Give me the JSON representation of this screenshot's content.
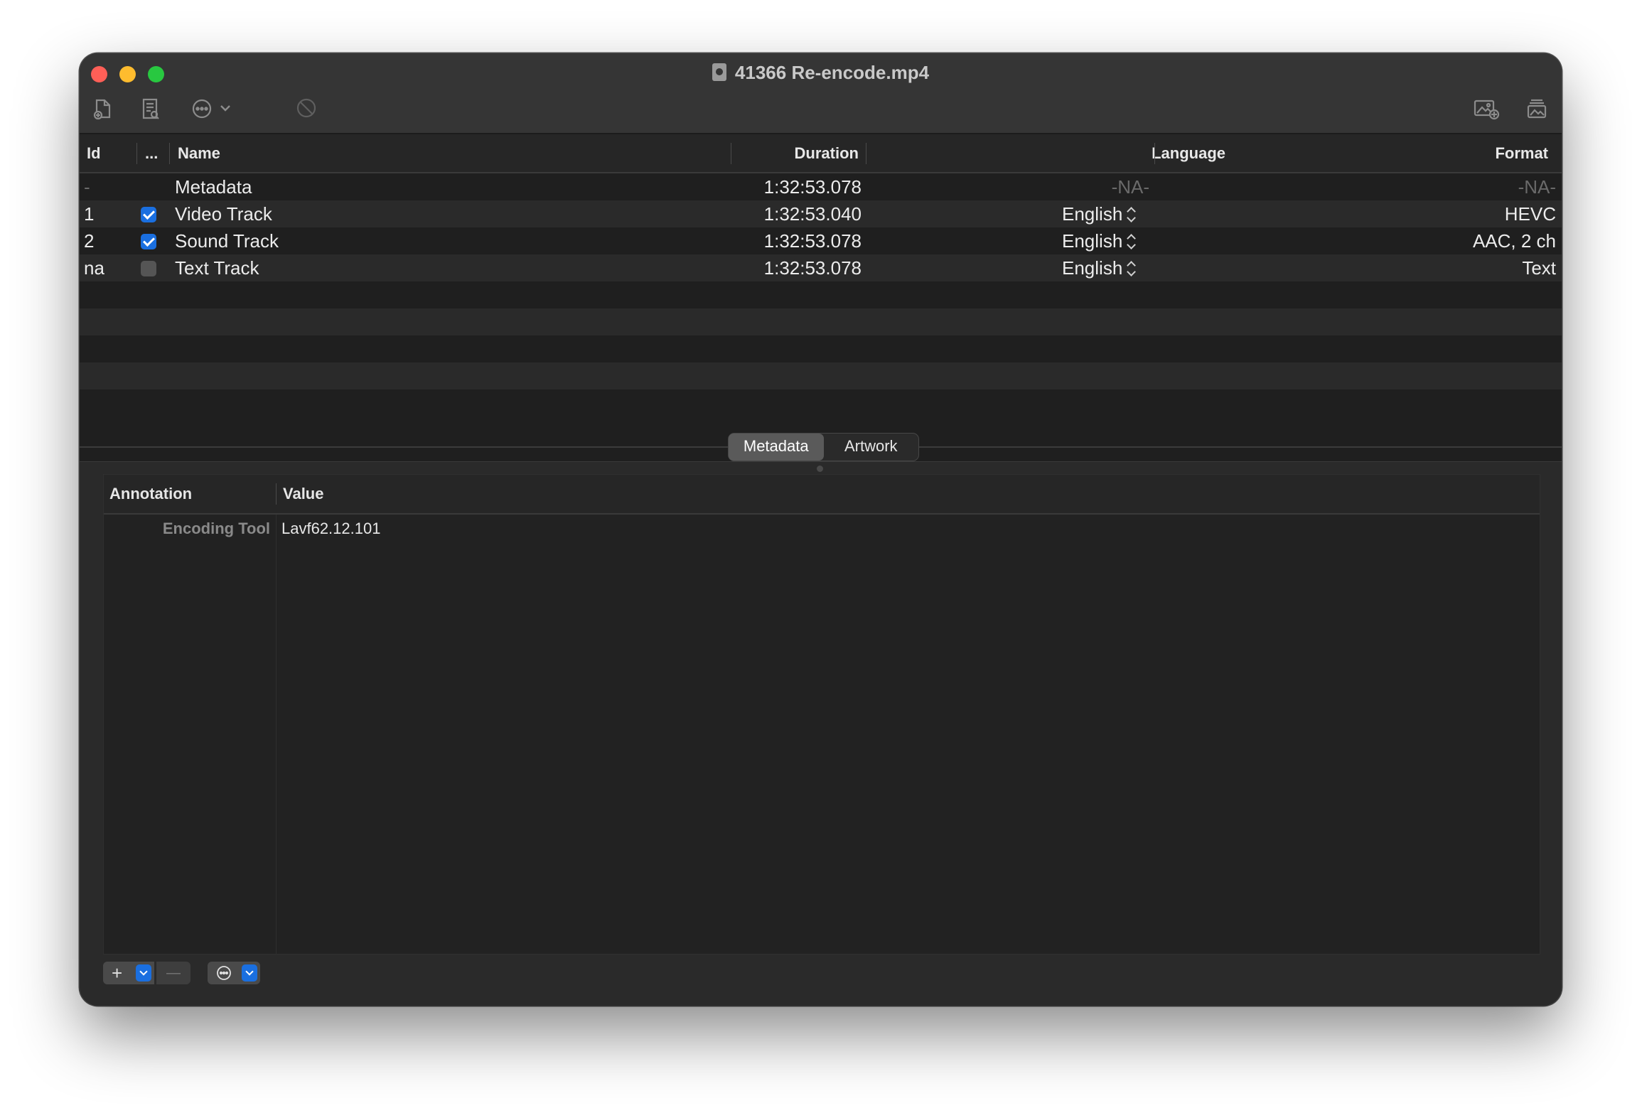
{
  "window": {
    "title": "41366 Re-encode.mp4"
  },
  "toolbar": {
    "icons": [
      "add-file-icon",
      "info-document-icon",
      "more-actions-icon",
      "chevron-down-icon",
      "disabled-circle-icon",
      "add-artwork-icon",
      "artwork-icon"
    ]
  },
  "tracks": {
    "columns": {
      "id": "Id",
      "enabled": "...",
      "name": "Name",
      "duration": "Duration",
      "language": "Language",
      "format": "Format"
    },
    "rows": [
      {
        "id": "-",
        "checked": null,
        "name": "Metadata",
        "duration": "1:32:53.078",
        "language": "-NA-",
        "format": "-NA-"
      },
      {
        "id": "1",
        "checked": true,
        "name": "Video Track",
        "duration": "1:32:53.040",
        "language": "English",
        "format": "HEVC"
      },
      {
        "id": "2",
        "checked": true,
        "name": "Sound Track",
        "duration": "1:32:53.078",
        "language": "English",
        "format": "AAC, 2 ch"
      },
      {
        "id": "na",
        "checked": false,
        "name": "Text Track",
        "duration": "1:32:53.078",
        "language": "English",
        "format": "Text"
      }
    ]
  },
  "tabs": {
    "metadata": "Metadata",
    "artwork": "Artwork",
    "selected": "Metadata"
  },
  "metadata_table": {
    "columns": {
      "annotation": "Annotation",
      "value": "Value"
    },
    "rows": [
      {
        "annotation": "Encoding Tool",
        "value": "Lavf62.12.101"
      }
    ]
  },
  "bottom_bar": {
    "add_label": "+",
    "remove_label": "—"
  },
  "colors": {
    "accent": "#1a6fe0",
    "close": "#ff5f57",
    "minimize": "#febc2e",
    "maximize": "#28c840"
  }
}
